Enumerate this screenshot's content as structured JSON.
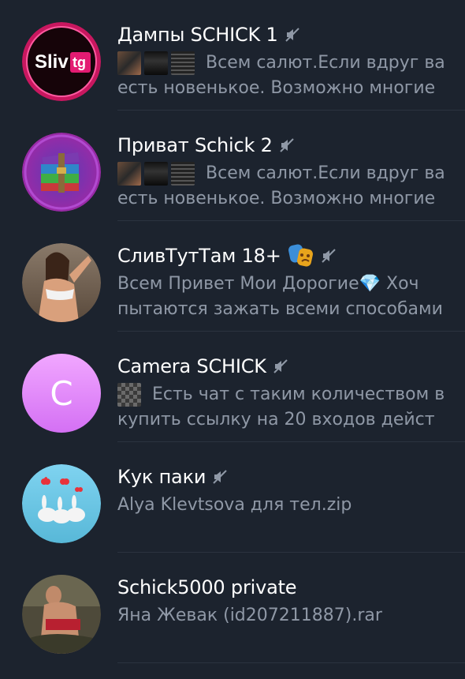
{
  "chats": [
    {
      "title": "Дампы SCHICK 1",
      "muted": true,
      "avatar": {
        "type": "logo",
        "text_a": "Sliv",
        "text_b": "tg"
      },
      "preview_lines": [
        "Всем салют.Если вдруг ва",
        "есть новенькое. Возможно многие"
      ],
      "has_thumbs": true
    },
    {
      "title": "Приват Schick 2",
      "muted": true,
      "avatar": {
        "type": "winrar"
      },
      "preview_lines": [
        "Всем салют.Если вдруг ва",
        "есть новенькое. Возможно многие"
      ],
      "has_thumbs": true
    },
    {
      "title": "СливТутТам 18+",
      "muted": true,
      "avatar": {
        "type": "photo"
      },
      "preview_lines": [
        "Всем Привет Мои Дорогие💎  Хоч",
        "пытаются зажать всеми способами"
      ]
    },
    {
      "title": "Camera SCHICK",
      "muted": true,
      "avatar": {
        "type": "letter",
        "letter": "C"
      },
      "preview_lines": [
        "Есть чат с таким количеством в",
        "купить ссылку на 20 входов дейст"
      ],
      "has_single_thumb": true
    },
    {
      "title": "Кук паки",
      "muted": true,
      "avatar": {
        "type": "bunnies"
      },
      "preview_lines": [
        "Alya Klevtsova  для тел.zip"
      ]
    },
    {
      "title": "Schick5000 private",
      "muted": false,
      "avatar": {
        "type": "photo2"
      },
      "preview_lines": [
        "Яна Жевак (id207211887).rar"
      ]
    }
  ],
  "icons": {
    "mute": "muted-speaker-icon",
    "mask": "performing-arts-emoji"
  },
  "colors": {
    "background": "#1c232e",
    "title": "#ffffff",
    "preview": "#8f98a6",
    "separator": "#2b333f"
  }
}
